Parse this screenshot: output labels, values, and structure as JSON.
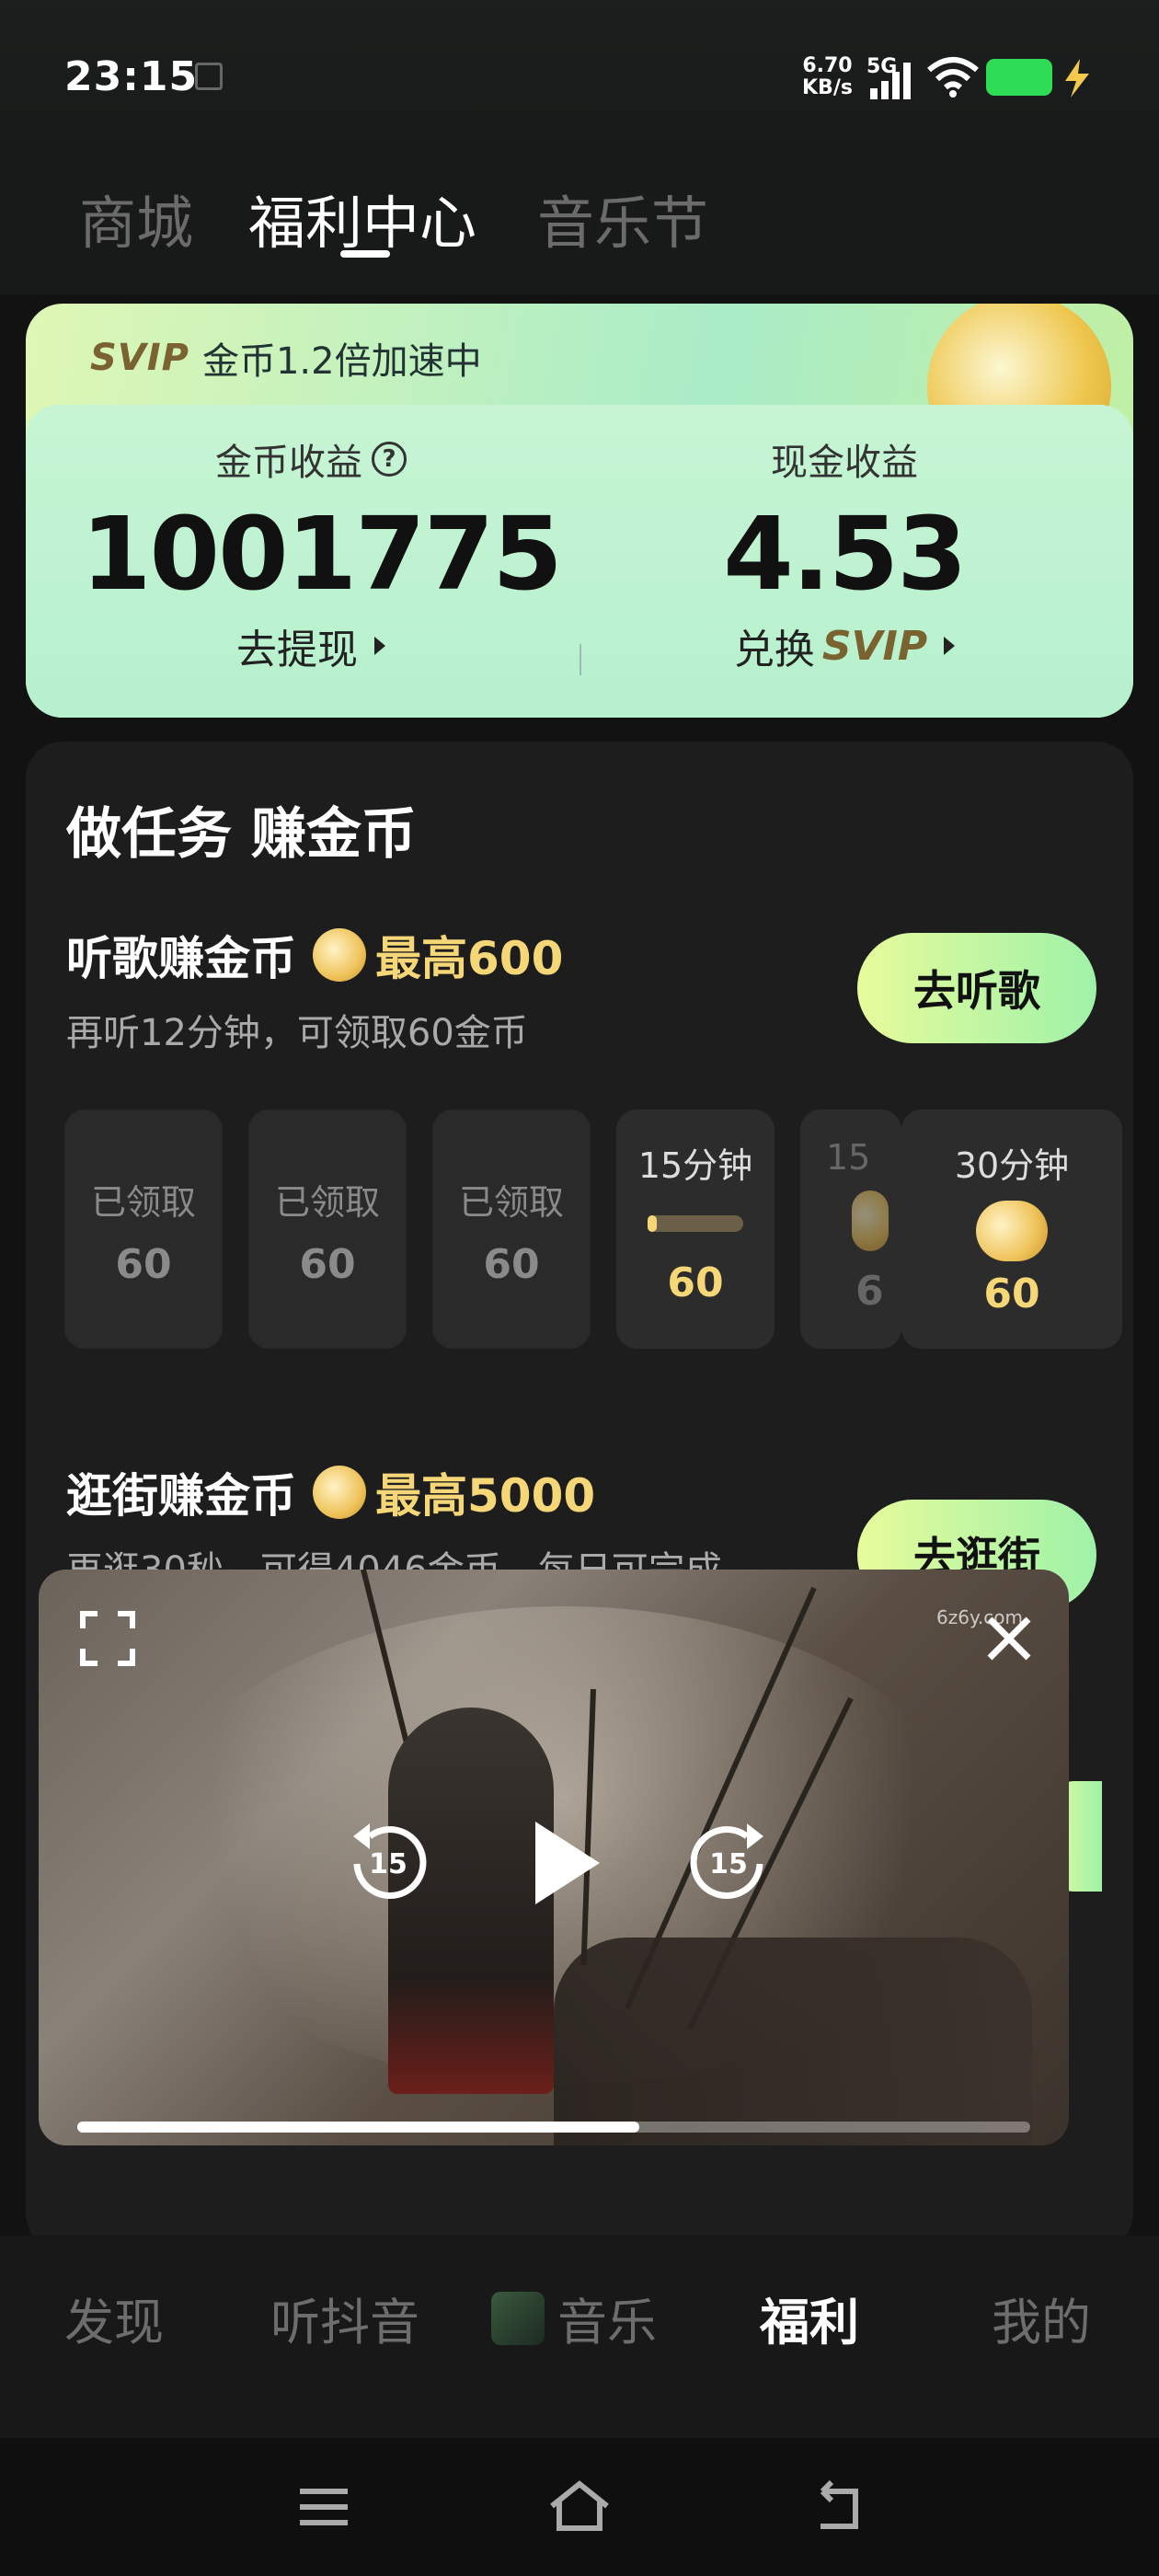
{
  "status_bar": {
    "time": "23:15",
    "net_speed_top": "6.70",
    "net_speed_bottom": "KB/s",
    "network": "5G",
    "battery_color": "#2FDC55",
    "charging_bolt_color": "#F2C94C"
  },
  "top_tabs": [
    {
      "label": "商城",
      "active": false
    },
    {
      "label": "福利中心",
      "active": true
    },
    {
      "label": "音乐节",
      "active": false
    }
  ],
  "svip_banner": {
    "logo": "SVIP",
    "text": "金币1.2倍加速中"
  },
  "earnings": {
    "coin_label": "金币收益",
    "coin_value": "1001775",
    "coin_action": "去提现",
    "cash_label": "现金收益",
    "cash_value": "4.53",
    "cash_action_prefix": "兑换",
    "cash_action_brand": "SVIP"
  },
  "tasks": {
    "title": "做任务 赚金币",
    "listen": {
      "name": "听歌赚金币",
      "max": "最高600",
      "desc": "再听12分钟，可领取60金币",
      "button": "去听歌",
      "slots": [
        {
          "state": "已领取",
          "value": "60"
        },
        {
          "state": "已领取",
          "value": "60"
        },
        {
          "state": "已领取",
          "value": "60"
        }
      ],
      "active_slot": {
        "label": "15分钟",
        "value": "60",
        "progress": 0.1
      },
      "partial_slot": {
        "label": "15",
        "value": "6"
      },
      "last_slot": {
        "label": "30分钟",
        "value": "60"
      }
    },
    "shop": {
      "name": "逛街赚金币",
      "max": "最高5000",
      "desc": "再逛30秒，可得4046金币，每日可完成",
      "button": "去逛街"
    }
  },
  "video_player": {
    "watermark": "6z6y.com",
    "rewind_seconds": "15",
    "forward_seconds": "15",
    "progress": 0.59
  },
  "bottom_tabs": [
    {
      "label": "发现",
      "active": false
    },
    {
      "label": "听抖音",
      "active": false
    },
    {
      "label": "音乐",
      "active": false
    },
    {
      "label": "福利",
      "active": true
    },
    {
      "label": "我的",
      "active": false
    }
  ]
}
